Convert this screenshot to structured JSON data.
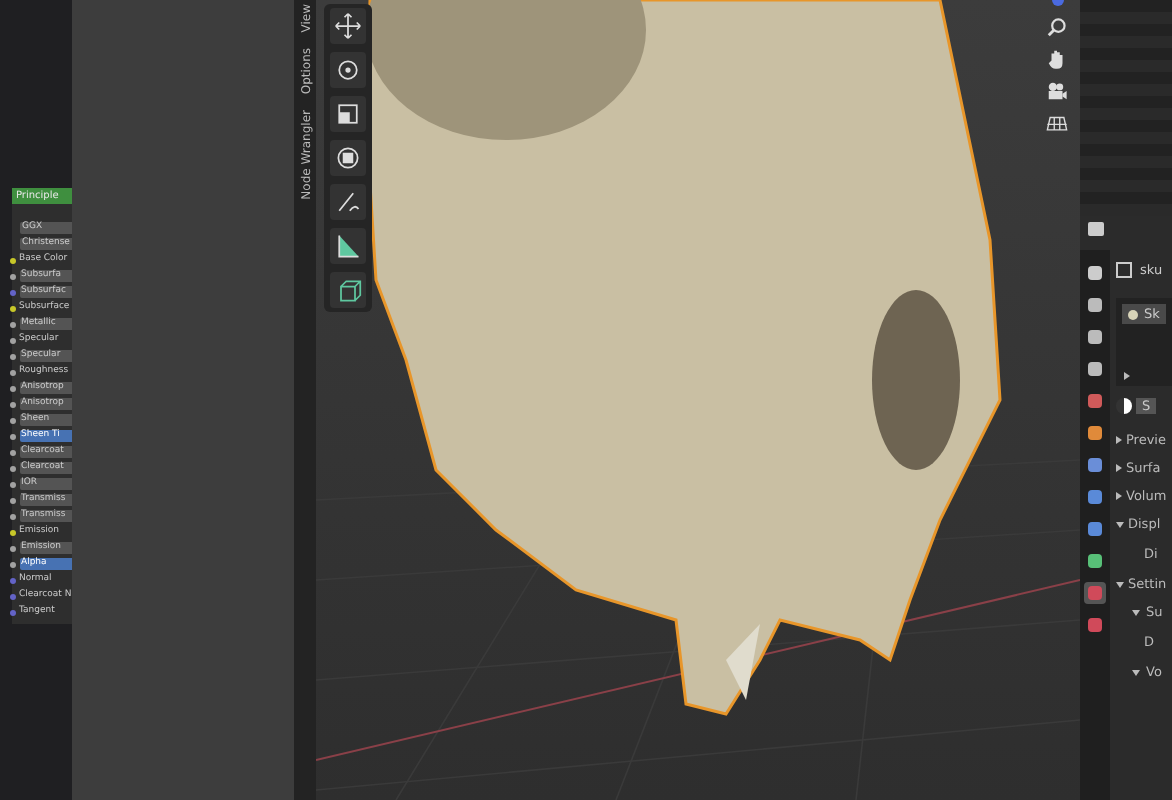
{
  "node_editor": {
    "node": {
      "title": "Principle",
      "rows": [
        {
          "label": "GGX",
          "kind": "field",
          "color": null,
          "highlighted": false
        },
        {
          "label": "Christense",
          "kind": "field",
          "color": null,
          "highlighted": false
        },
        {
          "label": "Base Color",
          "kind": "socket",
          "color": "#c7c729",
          "highlighted": false
        },
        {
          "label": "Subsurfa",
          "kind": "field",
          "color": "#a1a1a1",
          "highlighted": false
        },
        {
          "label": "Subsurfac",
          "kind": "field",
          "color": "#6363c7",
          "highlighted": false
        },
        {
          "label": "Subsurface",
          "kind": "socket",
          "color": "#c7c729",
          "highlighted": false
        },
        {
          "label": "Metallic",
          "kind": "field",
          "color": "#a1a1a1",
          "highlighted": false
        },
        {
          "label": "Specular",
          "kind": "socket",
          "color": "#a1a1a1",
          "highlighted": false
        },
        {
          "label": "Specular",
          "kind": "field",
          "color": "#a1a1a1",
          "highlighted": false
        },
        {
          "label": "Roughness",
          "kind": "socket",
          "color": "#a1a1a1",
          "highlighted": false
        },
        {
          "label": "Anisotrop",
          "kind": "field",
          "color": "#a1a1a1",
          "highlighted": false
        },
        {
          "label": "Anisotrop",
          "kind": "field",
          "color": "#a1a1a1",
          "highlighted": false
        },
        {
          "label": "Sheen",
          "kind": "field",
          "color": "#a1a1a1",
          "highlighted": false
        },
        {
          "label": "Sheen Ti",
          "kind": "field",
          "color": "#a1a1a1",
          "highlighted": true
        },
        {
          "label": "Clearcoat",
          "kind": "field",
          "color": "#a1a1a1",
          "highlighted": false
        },
        {
          "label": "Clearcoat",
          "kind": "field",
          "color": "#a1a1a1",
          "highlighted": false
        },
        {
          "label": "IOR",
          "kind": "field",
          "color": "#a1a1a1",
          "highlighted": false
        },
        {
          "label": "Transmiss",
          "kind": "field",
          "color": "#a1a1a1",
          "highlighted": false
        },
        {
          "label": "Transmiss",
          "kind": "field",
          "color": "#a1a1a1",
          "highlighted": false
        },
        {
          "label": "Emission",
          "kind": "socket",
          "color": "#c7c729",
          "highlighted": false
        },
        {
          "label": "Emission",
          "kind": "field",
          "color": "#a1a1a1",
          "highlighted": false
        },
        {
          "label": "Alpha",
          "kind": "field",
          "color": "#a1a1a1",
          "highlighted": true
        },
        {
          "label": "Normal",
          "kind": "socket",
          "color": "#6363c7",
          "highlighted": false
        },
        {
          "label": "Clearcoat N",
          "kind": "socket",
          "color": "#6363c7",
          "highlighted": false
        },
        {
          "label": "Tangent",
          "kind": "socket",
          "color": "#6363c7",
          "highlighted": false
        }
      ]
    }
  },
  "side_tabs": [
    "View",
    "Options",
    "Node Wrangler"
  ],
  "properties": {
    "tabs": [
      {
        "color": "#cccccc",
        "selected": false
      },
      {
        "color": "#bbbbbb",
        "selected": false
      },
      {
        "color": "#bbbbbb",
        "selected": false
      },
      {
        "color": "#bbbbbb",
        "selected": false
      },
      {
        "color": "#d05a5a",
        "selected": false
      },
      {
        "color": "#e08a3a",
        "selected": false
      },
      {
        "color": "#6a8ed8",
        "selected": false
      },
      {
        "color": "#5a8ad8",
        "selected": false
      },
      {
        "color": "#5a8ad8",
        "selected": false
      },
      {
        "color": "#58c078",
        "selected": false
      },
      {
        "color": "#d04a5a",
        "selected": true
      },
      {
        "color": "#d04a5a",
        "selected": false
      }
    ],
    "object_name": "sku",
    "material_slot": "Sk",
    "material_name": "S",
    "sections": [
      {
        "label": "Previe",
        "expanded": false
      },
      {
        "label": "Surfa",
        "expanded": false
      },
      {
        "label": "Volum",
        "expanded": false
      },
      {
        "label": "Displ",
        "expanded": true,
        "children": [
          {
            "label": "Di"
          }
        ]
      },
      {
        "label": "Settin",
        "expanded": true,
        "children": [
          {
            "label": "Su",
            "expanded": true,
            "children": [
              {
                "label": "D"
              }
            ]
          },
          {
            "label": "Vo",
            "expanded": true
          }
        ]
      }
    ]
  }
}
